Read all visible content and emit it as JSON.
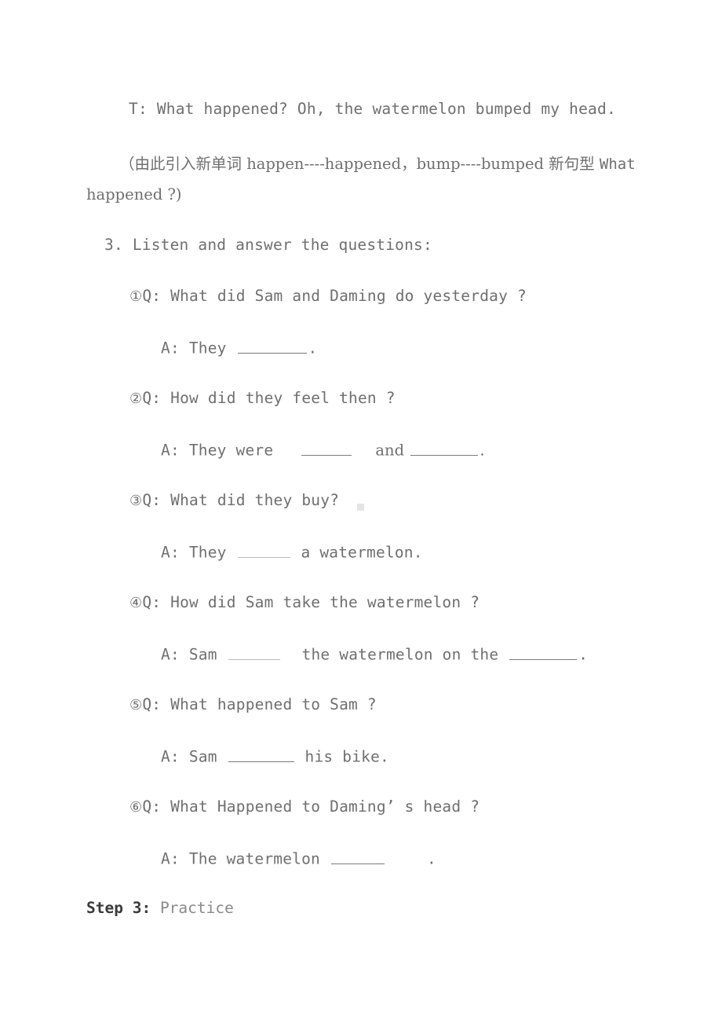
{
  "document": {
    "page_background": "#ffffff",
    "text_color": "#6f6f6f",
    "blank_color": "#7a7a7a",
    "blank_color_light": "#b9b9b9"
  },
  "content": {
    "teacher_line": "T: What happened? Oh, the watermelon bumped my head.",
    "note_line_part1": "（由此引入新单词 happen----happened，bump----bumped 新句型 ",
    "note_line_part2": "What",
    "note_line_wrapped": "happened ?)",
    "section_number": "3.",
    "section_title": "Listen and answer the questions:",
    "step_label": "Step 3:",
    "step_title": "Practice"
  },
  "questions": [
    {
      "marker": "①",
      "q_prefix": "Q: ",
      "q_text": "What did Sam and Daming do yesterday ?",
      "a_prefix": "A: ",
      "a_before": "They ",
      "blank1_width": 88,
      "blank1_light": false,
      "a_middle": "",
      "blank2_width": 0,
      "a_after": ".",
      "gap_width": 0
    },
    {
      "marker": "②",
      "q_prefix": "Q: ",
      "q_text": "How did they feel then ?",
      "a_prefix": "A: ",
      "a_before": "They were ",
      "blank1_width": 64,
      "blank1_light": false,
      "a_middle": " and ",
      "blank2_width": 86,
      "a_after": ".",
      "gap_width": 22
    },
    {
      "marker": "③",
      "q_prefix": "Q: ",
      "q_text": "What did they buy?",
      "a_prefix": "A: ",
      "a_before": "They ",
      "blank1_width": 67,
      "blank1_light": true,
      "a_middle": " a watermelon.",
      "blank2_width": 0,
      "a_after": "",
      "gap_width": 0
    },
    {
      "marker": "④",
      "q_prefix": "Q: ",
      "q_text": "How did Sam take the watermelon ?",
      "a_prefix": "A: ",
      "a_before": "Sam ",
      "blank1_width": 66,
      "blank1_light": true,
      "a_middle": " the watermelon on the ",
      "blank2_width": 86,
      "a_after": ".",
      "gap_width": 14
    },
    {
      "marker": "⑤",
      "q_prefix": "Q: ",
      "q_text": "What happened to Sam ?",
      "a_prefix": "A: ",
      "a_before": "Sam ",
      "blank1_width": 84,
      "blank1_light": false,
      "a_middle": " his bike.",
      "blank2_width": 0,
      "a_after": "",
      "gap_width": 0
    },
    {
      "marker": "⑥",
      "q_prefix": "Q: ",
      "q_text": "What Happened to Daming’ s head ?",
      "a_prefix": "A: ",
      "a_before": "The watermelon ",
      "blank1_width": 68,
      "blank1_light": false,
      "a_middle": "",
      "blank2_width": 0,
      "a_after": ".",
      "gap_width": 52
    }
  ]
}
